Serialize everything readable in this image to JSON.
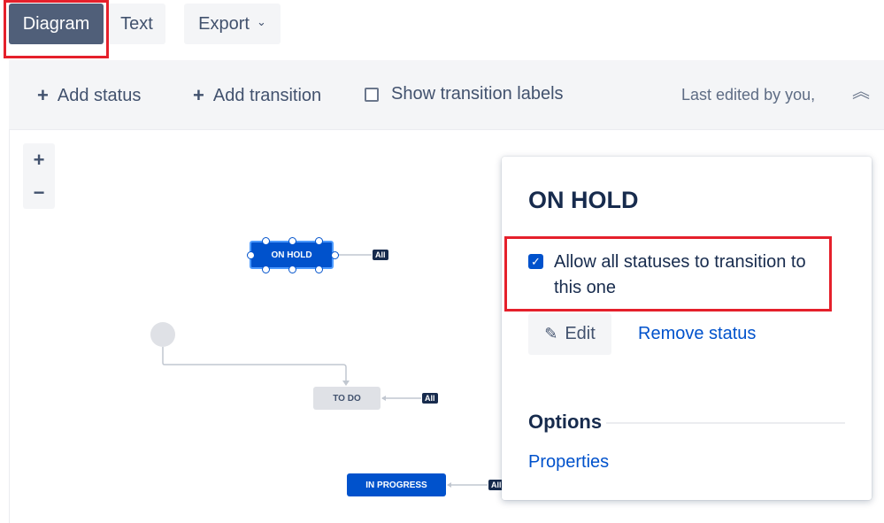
{
  "view_toggle": {
    "diagram": "Diagram",
    "text": "Text",
    "export": "Export"
  },
  "toolbar": {
    "add_status": "Add status",
    "add_transition": "Add transition",
    "show_labels": "Show transition labels",
    "show_labels_checked": false,
    "last_edited": "Last edited by you,"
  },
  "zoom": {
    "in": "+",
    "out": "−"
  },
  "diagram": {
    "nodes": [
      {
        "label": "ON HOLD",
        "selected": true
      },
      {
        "label": "TO DO"
      },
      {
        "label": "IN PROGRESS"
      }
    ],
    "global_transition_badge": "All"
  },
  "panel": {
    "title": "ON HOLD",
    "allow_all_label": "Allow all statuses to transition to this one",
    "allow_all_checked": true,
    "edit_label": "Edit",
    "remove_label": "Remove status",
    "options_heading": "Options",
    "properties_link": "Properties"
  },
  "colors": {
    "primary_blue": "#0052cc",
    "selected_tab": "#505f79",
    "highlight_red": "#e5202b"
  }
}
